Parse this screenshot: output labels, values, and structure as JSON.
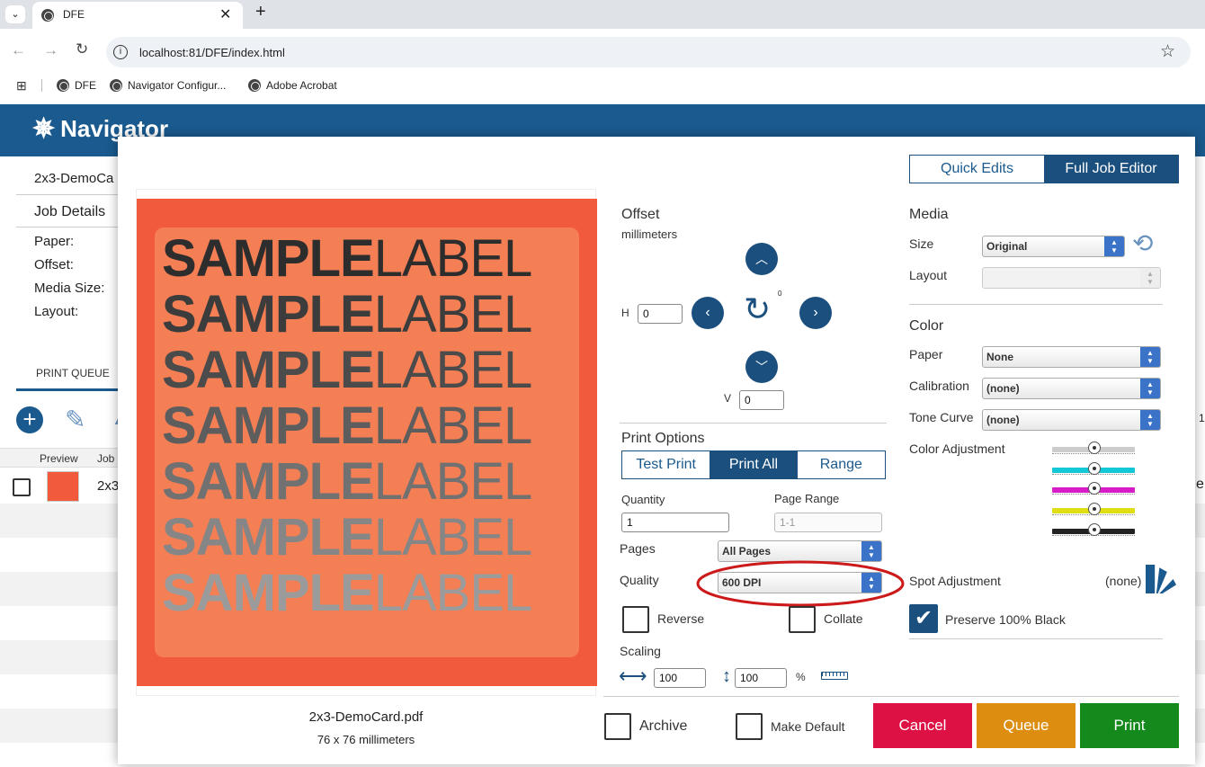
{
  "browser": {
    "tab_title": "DFE",
    "url": "localhost:81/DFE/index.html",
    "bookmarks": [
      "DFE",
      "Navigator Configur...",
      "Adobe Acrobat"
    ]
  },
  "app": {
    "logo": "Navigator",
    "job_name": "2x3-DemoCa",
    "job_details": "Job Details",
    "details_labels": [
      "Paper:",
      "Offset:",
      "Media Size:",
      "Layout:"
    ],
    "print_queue_tab": "PRINT QUEUE",
    "col_preview": "Preview",
    "col_job": "Job",
    "row_job": "2x3",
    "edge_e": "e",
    "edge_1": "1"
  },
  "modal": {
    "tabs": {
      "quick": "Quick Edits",
      "full": "Full Job Editor"
    },
    "preview": {
      "line_bold": "SAMPLE",
      "line_light": "LABEL",
      "filename": "2x3-DemoCard.pdf",
      "dimensions": "76 x 76 millimeters"
    },
    "offset": {
      "title": "Offset",
      "units": "millimeters",
      "h_label": "H",
      "h_value": "0",
      "v_label": "V",
      "v_value": "0",
      "rotation": "0"
    },
    "print_options": {
      "title": "Print Options",
      "modes": [
        "Test Print",
        "Print All",
        "Range"
      ],
      "selected_mode": "Print All",
      "quantity_label": "Quantity",
      "quantity_value": "1",
      "page_range_label": "Page Range",
      "page_range_placeholder": "1-1",
      "pages_label": "Pages",
      "pages_value": "All Pages",
      "quality_label": "Quality",
      "quality_value": "600 DPI",
      "reverse_label": "Reverse",
      "collate_label": "Collate",
      "scaling_label": "Scaling",
      "scale_w": "100",
      "scale_h": "100",
      "percent": "%"
    },
    "media": {
      "title": "Media",
      "size_label": "Size",
      "size_value": "Original",
      "layout_label": "Layout",
      "layout_value": ""
    },
    "color": {
      "title": "Color",
      "paper_label": "Paper",
      "paper_value": "None",
      "calibration_label": "Calibration",
      "calibration_value": "(none)",
      "tone_label": "Tone Curve",
      "tone_value": "(none)",
      "adjustment_label": "Color Adjustment",
      "spot_label": "Spot Adjustment",
      "spot_value": "(none)",
      "preserve_label": "Preserve 100% Black",
      "preserve_checked": true,
      "slider_colors": [
        "#cccccc",
        "#12c8d6",
        "#d81dc8",
        "#dede10",
        "#222222"
      ]
    },
    "footer": {
      "archive": "Archive",
      "make_default": "Make Default",
      "cancel": "Cancel",
      "queue": "Queue",
      "print": "Print"
    },
    "colors": {
      "accent": "#1a4f7e",
      "cancel": "#dd1144",
      "queue": "#dd8e10",
      "print": "#158a1c",
      "annotation": "#cc1a1a",
      "label_bg": "#f15b3b"
    }
  }
}
